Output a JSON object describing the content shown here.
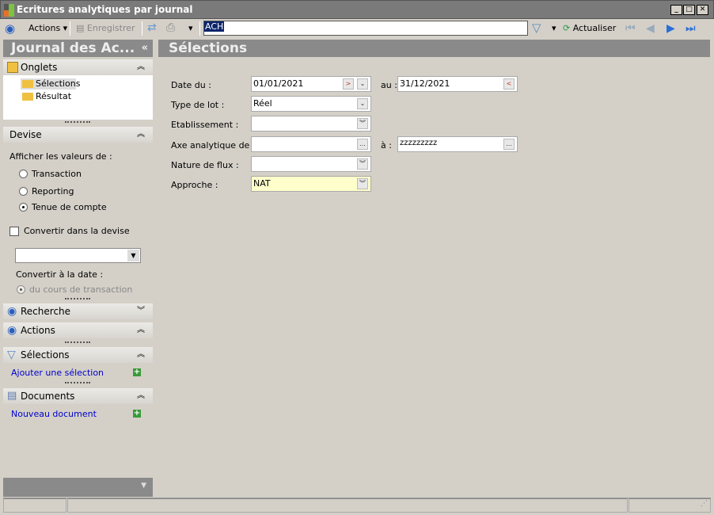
{
  "window": {
    "title": "Ecritures analytiques par journal"
  },
  "toolbar": {
    "actions": "Actions",
    "save": "Enregistrer",
    "search_value": "ACH",
    "refresh": "Actualiser"
  },
  "left": {
    "title": "Journal des Ac...",
    "onglets": {
      "label": "Onglets",
      "items": [
        "Sélections",
        "Résultat"
      ]
    },
    "devise": {
      "label": "Devise",
      "show_values": "Afficher les valeurs de :",
      "options": [
        "Transaction",
        "Reporting",
        "Tenue de compte"
      ],
      "selected": "Tenue de compte",
      "convert": "Convertir dans la devise",
      "convert_date": "Convertir à la date :",
      "date_option": "du cours de transaction"
    },
    "recherche": "Recherche",
    "actions": "Actions",
    "selections": {
      "label": "Sélections",
      "link": "Ajouter une sélection"
    },
    "documents": {
      "label": "Documents",
      "link": "Nouveau document"
    }
  },
  "main": {
    "title": "Sélections",
    "fields": {
      "date_du": {
        "label": "Date du :",
        "value": "01/01/2021"
      },
      "date_au": {
        "label": "au :",
        "value": "31/12/2021"
      },
      "type_lot": {
        "label": "Type de lot :",
        "value": "Réel"
      },
      "etab": {
        "label": "Etablissement :",
        "value": ""
      },
      "axe": {
        "label": "Axe analytique de :",
        "value": ""
      },
      "axe_a": {
        "label": "à :",
        "value": "zzzzzzzzz"
      },
      "nature": {
        "label": "Nature de flux :",
        "value": ""
      },
      "approche": {
        "label": "Approche :",
        "value": "NAT"
      }
    }
  },
  "colors": {
    "highlight_field": "#ffffcc",
    "header": "#8a8a8a"
  }
}
